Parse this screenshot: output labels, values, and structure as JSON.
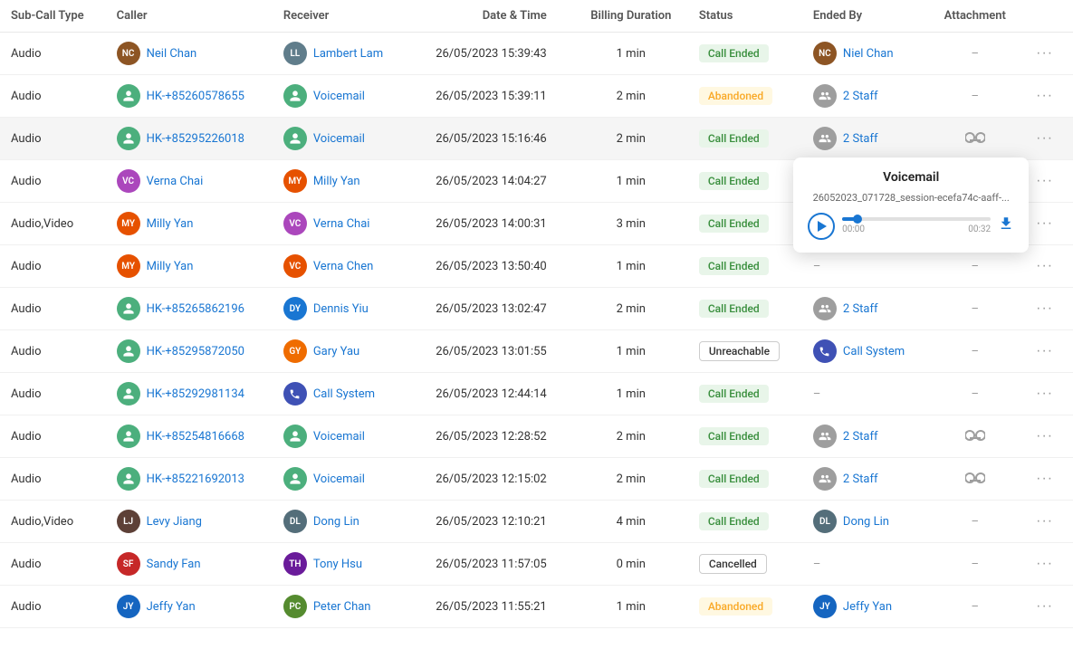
{
  "columns": [
    {
      "key": "subCallType",
      "label": "Sub-Call Type"
    },
    {
      "key": "caller",
      "label": "Caller"
    },
    {
      "key": "receiver",
      "label": "Receiver"
    },
    {
      "key": "dateTime",
      "label": "Date & Time"
    },
    {
      "key": "billingDuration",
      "label": "Billing Duration"
    },
    {
      "key": "status",
      "label": "Status"
    },
    {
      "key": "endedBy",
      "label": "Ended By"
    },
    {
      "key": "attachment",
      "label": "Attachment"
    }
  ],
  "rows": [
    {
      "id": 1,
      "subCallType": "Audio",
      "caller": {
        "name": "Neil Chan",
        "type": "photo",
        "initials": "NC",
        "color": "brown"
      },
      "receiver": {
        "name": "Lambert Lam",
        "type": "photo",
        "initials": "LL",
        "color": "gray"
      },
      "date": "26/05/2023",
      "time": "15:39:43",
      "billingDuration": "1 min",
      "status": "Call Ended",
      "statusType": "call-ended",
      "endedBy": {
        "name": "Niel Chan",
        "type": "photo",
        "initials": "NC"
      },
      "attachment": "—",
      "hasAttachment": false,
      "hasVoicemail": false,
      "highlighted": false
    },
    {
      "id": 2,
      "subCallType": "Audio",
      "caller": {
        "name": "HK-+85260578655",
        "type": "green-person",
        "initials": ""
      },
      "receiver": {
        "name": "Voicemail",
        "type": "green-person",
        "initials": ""
      },
      "date": "26/05/2023",
      "time": "15:39:11",
      "billingDuration": "2 min",
      "status": "Abandoned",
      "statusType": "abandoned",
      "endedBy": {
        "name": "2 Staff",
        "type": "multi-person"
      },
      "attachment": "—",
      "hasAttachment": false,
      "hasVoicemail": false,
      "highlighted": false
    },
    {
      "id": 3,
      "subCallType": "Audio",
      "caller": {
        "name": "HK-+85295226018",
        "type": "green-person",
        "initials": ""
      },
      "receiver": {
        "name": "Voicemail",
        "type": "green-person",
        "initials": ""
      },
      "date": "26/05/2023",
      "time": "15:16:46",
      "billingDuration": "2 min",
      "status": "Call Ended",
      "statusType": "call-ended",
      "endedBy": {
        "name": "2 Staff",
        "type": "multi-person"
      },
      "attachment": "voicemail",
      "hasAttachment": true,
      "hasVoicemail": true,
      "highlighted": true,
      "popup": {
        "title": "Voicemail",
        "filename": "26052023_071728_session-ecefa74c-aaff-...",
        "currentTime": "00:00",
        "totalTime": "00:32"
      }
    },
    {
      "id": 4,
      "subCallType": "Audio",
      "caller": {
        "name": "Verna Chai",
        "type": "photo",
        "initials": "VC"
      },
      "receiver": {
        "name": "Milly Yan",
        "type": "photo",
        "initials": "MY"
      },
      "date": "26/05/2023",
      "time": "14:04:27",
      "billingDuration": "1 min",
      "status": "Call Ended",
      "statusType": "call-ended",
      "endedBy": {
        "name": "",
        "type": "none"
      },
      "attachment": "—",
      "hasAttachment": false,
      "hasVoicemail": false,
      "highlighted": false
    },
    {
      "id": 5,
      "subCallType": "Audio,Video",
      "caller": {
        "name": "Milly Yan",
        "type": "photo",
        "initials": "MY"
      },
      "receiver": {
        "name": "Verna Chai",
        "type": "photo",
        "initials": "VC"
      },
      "date": "26/05/2023",
      "time": "14:00:31",
      "billingDuration": "3 min",
      "status": "Call Ended",
      "statusType": "call-ended",
      "endedBy": {
        "name": "",
        "type": "none"
      },
      "attachment": "—",
      "hasAttachment": false,
      "hasVoicemail": false,
      "highlighted": false
    },
    {
      "id": 6,
      "subCallType": "Audio",
      "caller": {
        "name": "Milly Yan",
        "type": "photo",
        "initials": "MY"
      },
      "receiver": {
        "name": "Verna Chen",
        "type": "photo",
        "initials": "VC"
      },
      "date": "26/05/2023",
      "time": "13:50:40",
      "billingDuration": "1 min",
      "status": "Call Ended",
      "statusType": "call-ended",
      "endedBy": {
        "name": "",
        "type": "none"
      },
      "attachment": "—",
      "hasAttachment": false,
      "hasVoicemail": false,
      "highlighted": false
    },
    {
      "id": 7,
      "subCallType": "Audio",
      "caller": {
        "name": "HK-+85265862196",
        "type": "green-person"
      },
      "receiver": {
        "name": "Dennis Yiu",
        "type": "initials-blue",
        "initials": "DY"
      },
      "date": "26/05/2023",
      "time": "13:02:47",
      "billingDuration": "2 min",
      "status": "Call Ended",
      "statusType": "call-ended",
      "endedBy": {
        "name": "2 Staff",
        "type": "multi-person"
      },
      "attachment": "—",
      "hasAttachment": false,
      "hasVoicemail": false,
      "highlighted": false
    },
    {
      "id": 8,
      "subCallType": "Audio",
      "caller": {
        "name": "HK-+85295872050",
        "type": "green-person"
      },
      "receiver": {
        "name": "Gary Yau",
        "type": "photo",
        "initials": "GY"
      },
      "date": "26/05/2023",
      "time": "13:01:55",
      "billingDuration": "1 min",
      "status": "Unreachable",
      "statusType": "unreachable",
      "endedBy": {
        "name": "Call System",
        "type": "call-system"
      },
      "attachment": "—",
      "hasAttachment": false,
      "hasVoicemail": false,
      "highlighted": false
    },
    {
      "id": 9,
      "subCallType": "Audio",
      "caller": {
        "name": "HK-+85292981134",
        "type": "green-person"
      },
      "receiver": {
        "name": "Call System",
        "type": "call-system-recv"
      },
      "date": "26/05/2023",
      "time": "12:44:14",
      "billingDuration": "1 min",
      "status": "Call Ended",
      "statusType": "call-ended",
      "endedBy": {
        "name": "",
        "type": "none"
      },
      "attachment": "—",
      "hasAttachment": false,
      "hasVoicemail": false,
      "highlighted": false
    },
    {
      "id": 10,
      "subCallType": "Audio",
      "caller": {
        "name": "HK-+85254816668",
        "type": "green-person"
      },
      "receiver": {
        "name": "Voicemail",
        "type": "green-person"
      },
      "date": "26/05/2023",
      "time": "12:28:52",
      "billingDuration": "2 min",
      "status": "Call Ended",
      "statusType": "call-ended",
      "endedBy": {
        "name": "2 Staff",
        "type": "multi-person"
      },
      "attachment": "voicemail",
      "hasAttachment": true,
      "hasVoicemail": true,
      "highlighted": false
    },
    {
      "id": 11,
      "subCallType": "Audio",
      "caller": {
        "name": "HK-+85221692013",
        "type": "green-person"
      },
      "receiver": {
        "name": "Voicemail",
        "type": "green-person"
      },
      "date": "26/05/2023",
      "time": "12:15:02",
      "billingDuration": "2 min",
      "status": "Call Ended",
      "statusType": "call-ended",
      "endedBy": {
        "name": "2 Staff",
        "type": "multi-person"
      },
      "attachment": "voicemail",
      "hasAttachment": true,
      "hasVoicemail": true,
      "highlighted": false
    },
    {
      "id": 12,
      "subCallType": "Audio,Video",
      "caller": {
        "name": "Levy Jiang",
        "type": "photo",
        "initials": "LJ"
      },
      "receiver": {
        "name": "Dong Lin",
        "type": "photo",
        "initials": "DL"
      },
      "date": "26/05/2023",
      "time": "12:10:21",
      "billingDuration": "4 min",
      "status": "Call Ended",
      "statusType": "call-ended",
      "endedBy": {
        "name": "Dong Lin",
        "type": "photo",
        "initials": "DL"
      },
      "attachment": "—",
      "hasAttachment": false,
      "hasVoicemail": false,
      "highlighted": false
    },
    {
      "id": 13,
      "subCallType": "Audio",
      "caller": {
        "name": "Sandy Fan",
        "type": "photo",
        "initials": "SF"
      },
      "receiver": {
        "name": "Tony Hsu",
        "type": "photo",
        "initials": "TH"
      },
      "date": "26/05/2023",
      "time": "11:57:05",
      "billingDuration": "0 min",
      "status": "Cancelled",
      "statusType": "cancelled",
      "endedBy": {
        "name": "",
        "type": "none"
      },
      "attachment": "—",
      "hasAttachment": false,
      "hasVoicemail": false,
      "highlighted": false
    },
    {
      "id": 14,
      "subCallType": "Audio",
      "caller": {
        "name": "Jeffy Yan",
        "type": "photo",
        "initials": "JY"
      },
      "receiver": {
        "name": "Peter Chan",
        "type": "photo",
        "initials": "PC"
      },
      "date": "26/05/2023",
      "time": "11:55:21",
      "billingDuration": "1 min",
      "status": "Abandoned",
      "statusType": "abandoned",
      "endedBy": {
        "name": "Jeffy Yan",
        "type": "photo",
        "initials": "JY"
      },
      "attachment": "—",
      "hasAttachment": false,
      "hasVoicemail": false,
      "highlighted": false
    }
  ],
  "moreButtonLabel": "···"
}
